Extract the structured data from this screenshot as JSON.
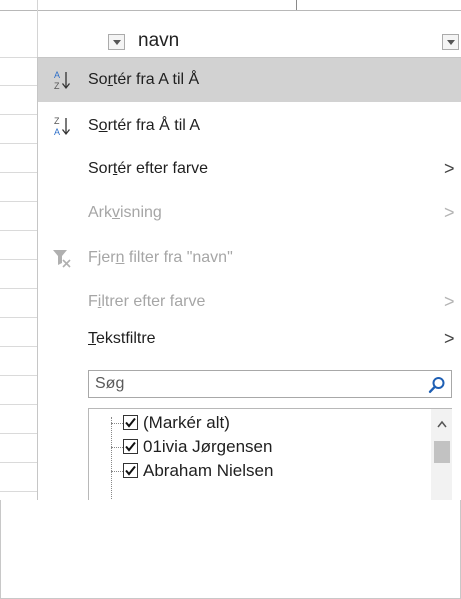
{
  "header": {
    "column_name": "navn"
  },
  "menu": {
    "sort_asc": {
      "pre": "So",
      "underline": "r",
      "post": "tér fra A til Å"
    },
    "sort_desc": {
      "pre": "S",
      "underline": "o",
      "post": "rtér fra Å til A"
    },
    "sort_by_color": {
      "pre": "Sor",
      "underline": "t",
      "post": "ér efter farve"
    },
    "sheet_view": {
      "pre": "Ark",
      "underline": "v",
      "post": "isning"
    },
    "clear_filter": {
      "pre": "Fjer",
      "underline": "n",
      "post": " filter fra \"navn\""
    },
    "filter_by_color": {
      "pre": "F",
      "underline": "i",
      "post": "ltrer efter farve"
    },
    "text_filters": {
      "pre": "",
      "underline": "T",
      "post": "ekstfiltre"
    },
    "chevron": ">",
    "sort_icon_top": "A",
    "sort_icon_bottom": "Z"
  },
  "search": {
    "placeholder": "Søg"
  },
  "list": {
    "items": [
      {
        "label": "(Markér alt)",
        "checked": true
      },
      {
        "label": "01ivia Jørgensen",
        "checked": true
      },
      {
        "label": "Abraham Nielsen",
        "checked": true
      }
    ]
  },
  "colors": {
    "highlight": "#d2d2d2",
    "disabled_text": "#a6a6a6",
    "sort_icon_blue": "#2e6fc8",
    "search_icon_blue": "#1e5fb4"
  }
}
